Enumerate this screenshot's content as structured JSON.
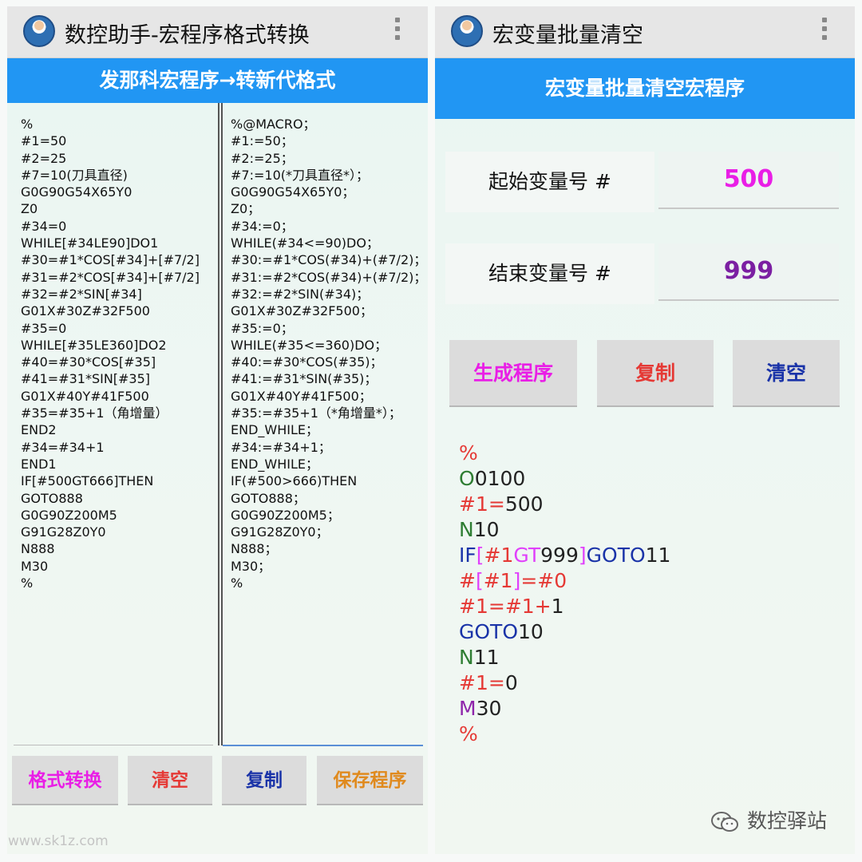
{
  "left_app": {
    "title": "数控助手-宏程序格式转换",
    "banner": "发那科宏程序→转新代格式",
    "input_code": "%\n#1=50\n#2=25\n#7=10(刀具直径)\nG0G90G54X65Y0\nZ0\n#34=0\nWHILE[#34LE90]DO1\n#30=#1*COS[#34]+[#7/2]\n#31=#2*COS[#34]+[#7/2]\n#32=#2*SIN[#34]\nG01X#30Z#32F500\n#35=0\nWHILE[#35LE360]DO2\n#40=#30*COS[#35]\n#41=#31*SIN[#35]\nG01X#40Y#41F500\n#35=#35+1（角增量）\nEND2\n#34=#34+1\nEND1\nIF[#500GT666]THEN\nGOTO888\nG0G90Z200M5\nG91G28Z0Y0\nN888\nM30\n%",
    "output_code": "%@MACRO；\n#1:=50；\n#2:=25；\n#7:=10(*刀具直径*）；\nG0G90G54X65Y0；\nZ0；\n#34:=0；\nWHILE(#34<=90)DO；\n#30:=#1*COS(#34)+(#7/2)；\n#31:=#2*COS(#34)+(#7/2)；\n#32:=#2*SIN(#34)；\nG01X#30Z#32F500；\n#35:=0；\nWHILE(#35<=360)DO；\n#40:=#30*COS(#35)；\n#41:=#31*SIN(#35)；\nG01X#40Y#41F500；\n#35:=#35+1（*角增量*）；\nEND_WHILE；\n#34:=#34+1；\nEND_WHILE；\nIF(#500>666)THEN\nGOTO888；\nG0G90Z200M5；\nG91G28Z0Y0；\nN888；\nM30；\n%",
    "buttons": {
      "convert": "格式转换",
      "clear": "清空",
      "copy": "复制",
      "save": "保存程序"
    }
  },
  "right_app": {
    "title": "宏变量批量清空",
    "banner": "宏变量批量清空宏程序",
    "start_label": "起始变量号 #",
    "start_value": "500",
    "end_label": "结束变量号 #",
    "end_value": "999",
    "buttons": {
      "generate": "生成程序",
      "copy": "复制",
      "clear": "清空"
    },
    "macro_lines": [
      [
        [
          "%",
          "#e53935"
        ]
      ],
      [
        [
          "O",
          "#2e7d32"
        ],
        [
          "0100",
          "#222222"
        ]
      ],
      [
        [
          "#1",
          "#e53935"
        ],
        [
          "=",
          "#e53935"
        ],
        [
          "500",
          "#222222"
        ]
      ],
      [
        [
          "N",
          "#2e7d32"
        ],
        [
          "10",
          "#222222"
        ]
      ],
      [
        [
          "IF",
          "#1a33a8"
        ],
        [
          "[",
          "#e040fb"
        ],
        [
          "#1",
          "#e53935"
        ],
        [
          "GT",
          "#e040fb"
        ],
        [
          "999",
          "#222222"
        ],
        [
          "]",
          "#e040fb"
        ],
        [
          "GOTO",
          "#1a33a8"
        ],
        [
          "11",
          "#222222"
        ]
      ],
      [
        [
          "#",
          "#e53935"
        ],
        [
          "[",
          "#e040fb"
        ],
        [
          "#1",
          "#e53935"
        ],
        [
          "]",
          "#e040fb"
        ],
        [
          "=",
          "#e53935"
        ],
        [
          "#0",
          "#e53935"
        ]
      ],
      [
        [
          "#1",
          "#e53935"
        ],
        [
          "=",
          "#e53935"
        ],
        [
          "#1",
          "#e53935"
        ],
        [
          "+",
          "#e53935"
        ],
        [
          "1",
          "#222222"
        ]
      ],
      [
        [
          "GOTO",
          "#1a33a8"
        ],
        [
          "10",
          "#222222"
        ]
      ],
      [
        [
          "N",
          "#2e7d32"
        ],
        [
          "11",
          "#222222"
        ]
      ],
      [
        [
          "#1",
          "#e53935"
        ],
        [
          "=",
          "#e53935"
        ],
        [
          "0",
          "#222222"
        ]
      ],
      [
        [
          "M",
          "#8e24aa"
        ],
        [
          "30",
          "#222222"
        ]
      ],
      [
        [
          "%",
          "#e53935"
        ]
      ]
    ]
  },
  "watermark": {
    "site": "www.sk1z.com",
    "brand": "数控驿站"
  },
  "colors": {
    "banner_blue": "#2196f3",
    "magenta": "#e91ee6",
    "red": "#e53935",
    "navy": "#1a33a8",
    "orange": "#e08a1e",
    "purple": "#7b1fa2"
  },
  "icons": [
    "app-logo-icon",
    "overflow-menu-icon",
    "wechat-icon"
  ]
}
